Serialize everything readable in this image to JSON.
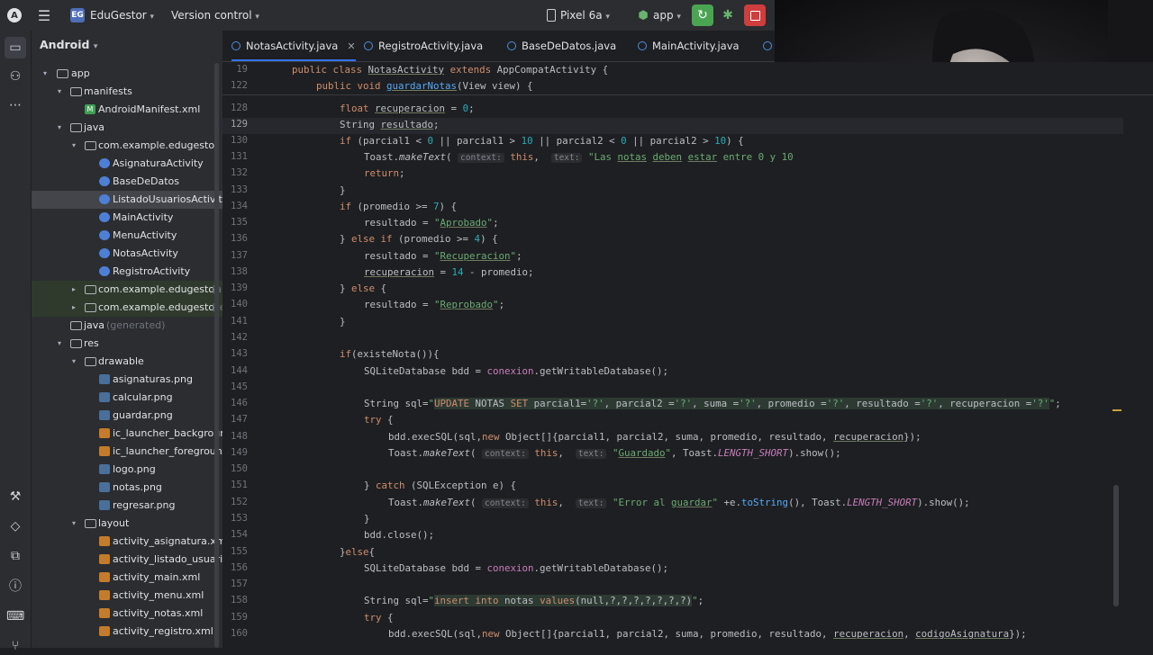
{
  "toolbar": {
    "project_badge": "EG",
    "project_name": "EduGestor",
    "vcs": "Version control",
    "device": "Pixel 6a",
    "run_config": "app"
  },
  "project_panel": {
    "title": "Android",
    "items": [
      {
        "label": "app",
        "extra": ""
      },
      {
        "label": "manifests",
        "extra": ""
      },
      {
        "label": "AndroidManifest.xml",
        "extra": ""
      },
      {
        "label": "java",
        "extra": ""
      },
      {
        "label": "com.example.edugestor",
        "extra": ""
      },
      {
        "label": "AsignaturaActivity",
        "extra": ""
      },
      {
        "label": "BaseDeDatos",
        "extra": ""
      },
      {
        "label": "ListadoUsuariosActivity",
        "extra": ""
      },
      {
        "label": "MainActivity",
        "extra": ""
      },
      {
        "label": "MenuActivity",
        "extra": ""
      },
      {
        "label": "NotasActivity",
        "extra": ""
      },
      {
        "label": "RegistroActivity",
        "extra": ""
      },
      {
        "label": "com.example.edugestor",
        "extra": "(a"
      },
      {
        "label": "com.example.edugestor",
        "extra": "(te"
      },
      {
        "label": "java",
        "extra": "(generated)"
      },
      {
        "label": "res",
        "extra": ""
      },
      {
        "label": "drawable",
        "extra": ""
      },
      {
        "label": "asignaturas.png",
        "extra": ""
      },
      {
        "label": "calcular.png",
        "extra": ""
      },
      {
        "label": "guardar.png",
        "extra": ""
      },
      {
        "label": "ic_launcher_background",
        "extra": ""
      },
      {
        "label": "ic_launcher_foreground",
        "extra": ""
      },
      {
        "label": "logo.png",
        "extra": ""
      },
      {
        "label": "notas.png",
        "extra": ""
      },
      {
        "label": "regresar.png",
        "extra": ""
      },
      {
        "label": "layout",
        "extra": ""
      },
      {
        "label": "activity_asignatura.xml",
        "extra": ""
      },
      {
        "label": "activity_listado_usuarios",
        "extra": ""
      },
      {
        "label": "activity_main.xml",
        "extra": ""
      },
      {
        "label": "activity_menu.xml",
        "extra": ""
      },
      {
        "label": "activity_notas.xml",
        "extra": ""
      },
      {
        "label": "activity_registro.xml",
        "extra": ""
      }
    ]
  },
  "tabs": [
    "NotasActivity.java",
    "RegistroActivity.java",
    "BaseDeDatos.java",
    "MainActivity.java"
  ],
  "editor": {
    "sticky_lines": [
      "19",
      "122"
    ],
    "line_numbers": [
      "128",
      "129",
      "130",
      "131",
      "132",
      "133",
      "134",
      "135",
      "136",
      "137",
      "138",
      "139",
      "140",
      "141",
      "142",
      "143",
      "144",
      "145",
      "146",
      "147",
      "148",
      "149",
      "150",
      "151",
      "152",
      "153",
      "154",
      "155",
      "156",
      "157",
      "158",
      "159",
      "160"
    ],
    "current_line": "129"
  }
}
